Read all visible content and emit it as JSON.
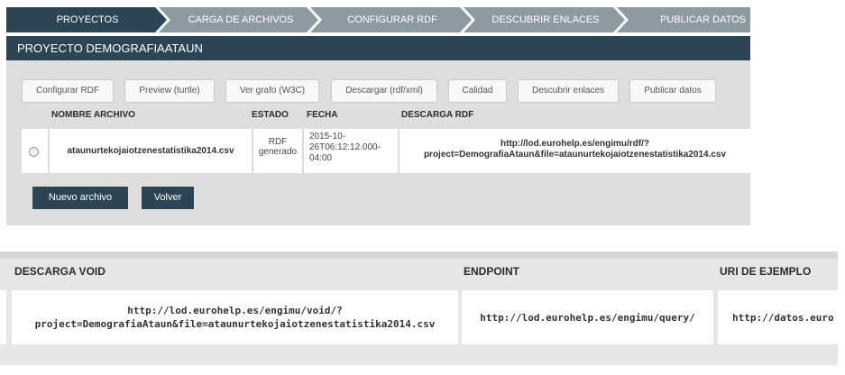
{
  "steps": [
    {
      "label": "PROYECTOS",
      "active": true
    },
    {
      "label": "CARGA DE ARCHIVOS",
      "active": false
    },
    {
      "label": "CONFIGURAR RDF",
      "active": false
    },
    {
      "label": "DESCUBRIR ENLACES",
      "active": false
    },
    {
      "label": "PUBLICAR DATOS",
      "active": false
    }
  ],
  "colors": {
    "active_step": "#2c4555",
    "inactive_step": "#8e9aa2",
    "header": "#2c4555",
    "panel": "#dedede"
  },
  "project": {
    "title": "PROYECTO DEMOGRAFIAATAUN"
  },
  "toolbar": {
    "configurar_rdf": "Configurar RDF",
    "preview": "Preview (turtle)",
    "ver_grafo": "Ver grafo (W3C)",
    "descargar": "Descargar (rdf/xml)",
    "calidad": "Calidad",
    "descubrir": "Descubrir enlaces",
    "publicar": "Publicar datos"
  },
  "table": {
    "headers": {
      "nombre": "NOMBRE ARCHIVO",
      "estado": "ESTADO",
      "fecha": "FECHA",
      "descarga": "DESCARGA RDF"
    },
    "row": {
      "nombre": "ataunurtekojaiotzenestatistika2014.csv",
      "estado_1": "RDF",
      "estado_2": "generado",
      "fecha_1": "2015-10-",
      "fecha_2": "26T06:12:12.000-",
      "fecha_3": "04:00",
      "descarga_1": "http://lod.eurohelp.es/engimu/rdf/?",
      "descarga_2": "project=DemografiaAtaun&file=ataunurtekojaiotzenestatistika2014.csv"
    }
  },
  "actions": {
    "nuevo": "Nuevo archivo",
    "volver": "Volver"
  },
  "lower": {
    "headers": {
      "void": "DESCARGA VOID",
      "endpoint": "ENDPOINT",
      "uri": "URI DE EJEMPLO"
    },
    "void_1": "http://lod.eurohelp.es/engimu/void/?",
    "void_2": "project=DemografiaAtaun&file=ataunurtekojaiotzenestatistika2014.csv",
    "endpoint": "http://lod.eurohelp.es/engimu/query/",
    "uri": "http://datos.euro"
  }
}
